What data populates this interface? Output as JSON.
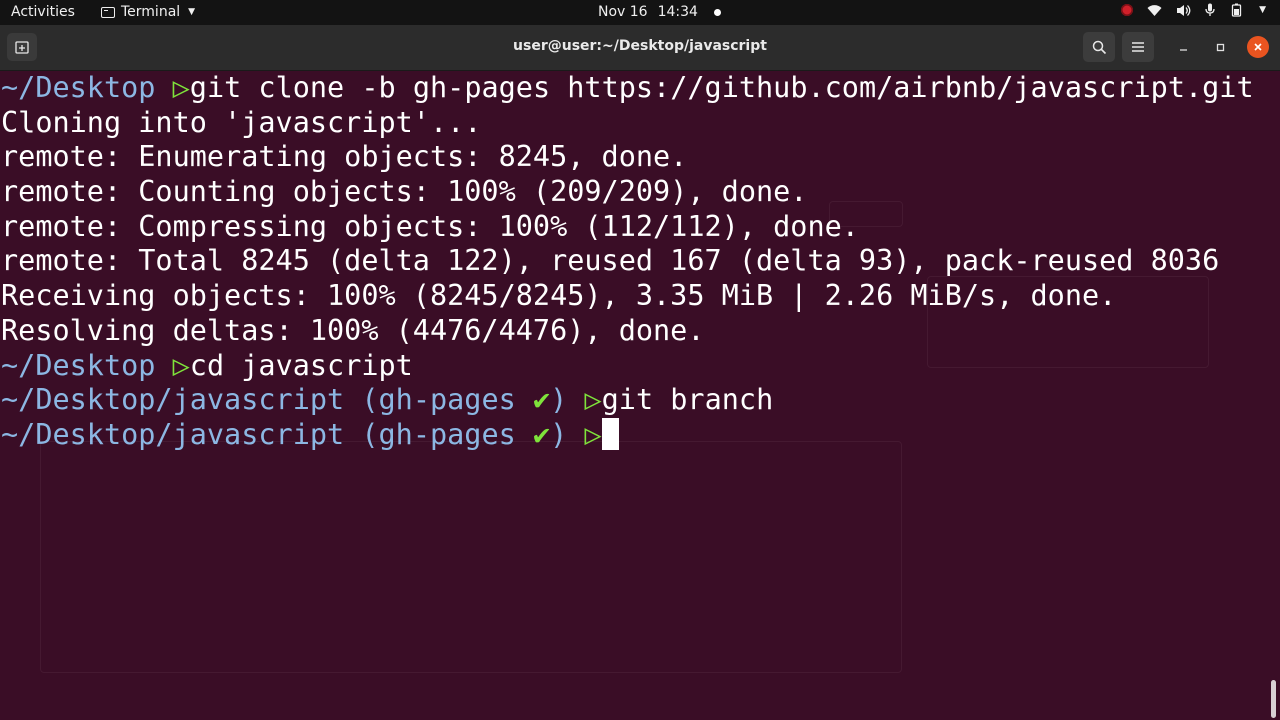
{
  "topbar": {
    "activities": "Activities",
    "app_name": "Terminal",
    "date": "Nov 16",
    "time": "14:34"
  },
  "window": {
    "title": "user@user:~/Desktop/javascript"
  },
  "terminal": {
    "lines": [
      {
        "type": "prompt",
        "path": "~/Desktop",
        "cmd": "git clone -b gh-pages https://github.com/airbnb/javascript.git"
      },
      {
        "type": "out",
        "text": "Cloning into 'javascript'..."
      },
      {
        "type": "out",
        "text": "remote: Enumerating objects: 8245, done."
      },
      {
        "type": "out",
        "text": "remote: Counting objects: 100% (209/209), done."
      },
      {
        "type": "out",
        "text": "remote: Compressing objects: 100% (112/112), done."
      },
      {
        "type": "out",
        "text": "remote: Total 8245 (delta 122), reused 167 (delta 93), pack-reused 8036"
      },
      {
        "type": "out",
        "text": "Receiving objects: 100% (8245/8245), 3.35 MiB | 2.26 MiB/s, done."
      },
      {
        "type": "out",
        "text": "Resolving deltas: 100% (4476/4476), done."
      },
      {
        "type": "prompt",
        "path": "~/Desktop",
        "cmd": "cd javascript"
      },
      {
        "type": "prompt",
        "path": "~/Desktop/javascript",
        "branch": "(gh-pages",
        "check": "✔)",
        "cmd": "git branch"
      },
      {
        "type": "prompt",
        "path": "~/Desktop/javascript",
        "branch": "(gh-pages",
        "check": "✔)",
        "cmd": ""
      }
    ],
    "prompt_symbol": "▷"
  },
  "colors": {
    "terminal_bg": "#3a0d26",
    "path": "#8cb7e3",
    "prompt": "#7fe33b",
    "close_button": "#e95420"
  },
  "icons": [
    "terminal-icon",
    "record-indicator-icon",
    "wifi-icon",
    "volume-icon",
    "microphone-icon",
    "battery-icon",
    "new-tab-icon",
    "search-icon",
    "menu-icon",
    "minimize-icon",
    "maximize-icon",
    "close-icon"
  ]
}
